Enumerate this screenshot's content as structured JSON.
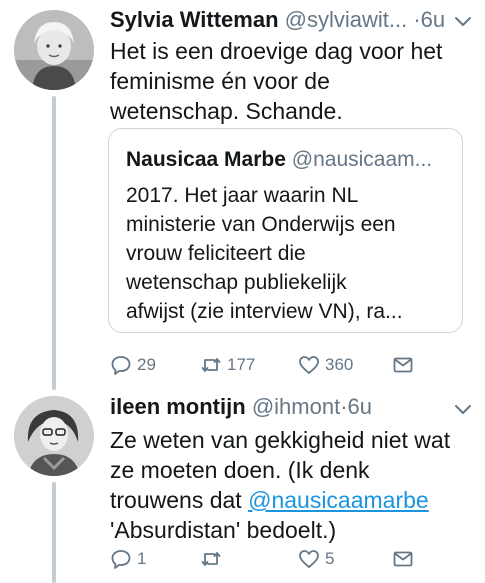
{
  "tweets": [
    {
      "name": "Sylvia Witteman",
      "handle": "@sylviawit...",
      "time": "·6u",
      "text": "Het is een droevige dag voor het\nfeminisme én voor de\nwetenschap. Schande.",
      "quote": {
        "name": "Nausicaa Marbe",
        "handle": "@nausicaam...",
        "text": "2017. Het jaar waarin NL\nministerie van Onderwijs een\nvrouw feliciteert die\nwetenschap publiekelijk\nafwijst (zie interview VN), ra..."
      },
      "replies": "29",
      "retweets": "177",
      "likes": "360"
    },
    {
      "name": "ileen montijn",
      "handle": "@ihmont",
      "time": "·6u",
      "text_before": "Ze weten van gekkigheid niet wat\nze moeten doen. (Ik denk\ntrouwens dat ",
      "mention": "@nausicaamarbe",
      "text_after": "\n'Absurdistan' bedoelt.)",
      "replies": "1",
      "retweets": "",
      "likes": "5"
    }
  ],
  "icons": {
    "reply": "reply-icon",
    "retweet": "retweet-icon",
    "like": "heart-icon",
    "dm": "envelope-icon",
    "menu": "chevron-down-icon"
  },
  "colors": {
    "text": "#14171a",
    "muted": "#657786",
    "link": "#1b95e0",
    "thread": "#c4ccd3",
    "border": "#ccd6dd"
  }
}
